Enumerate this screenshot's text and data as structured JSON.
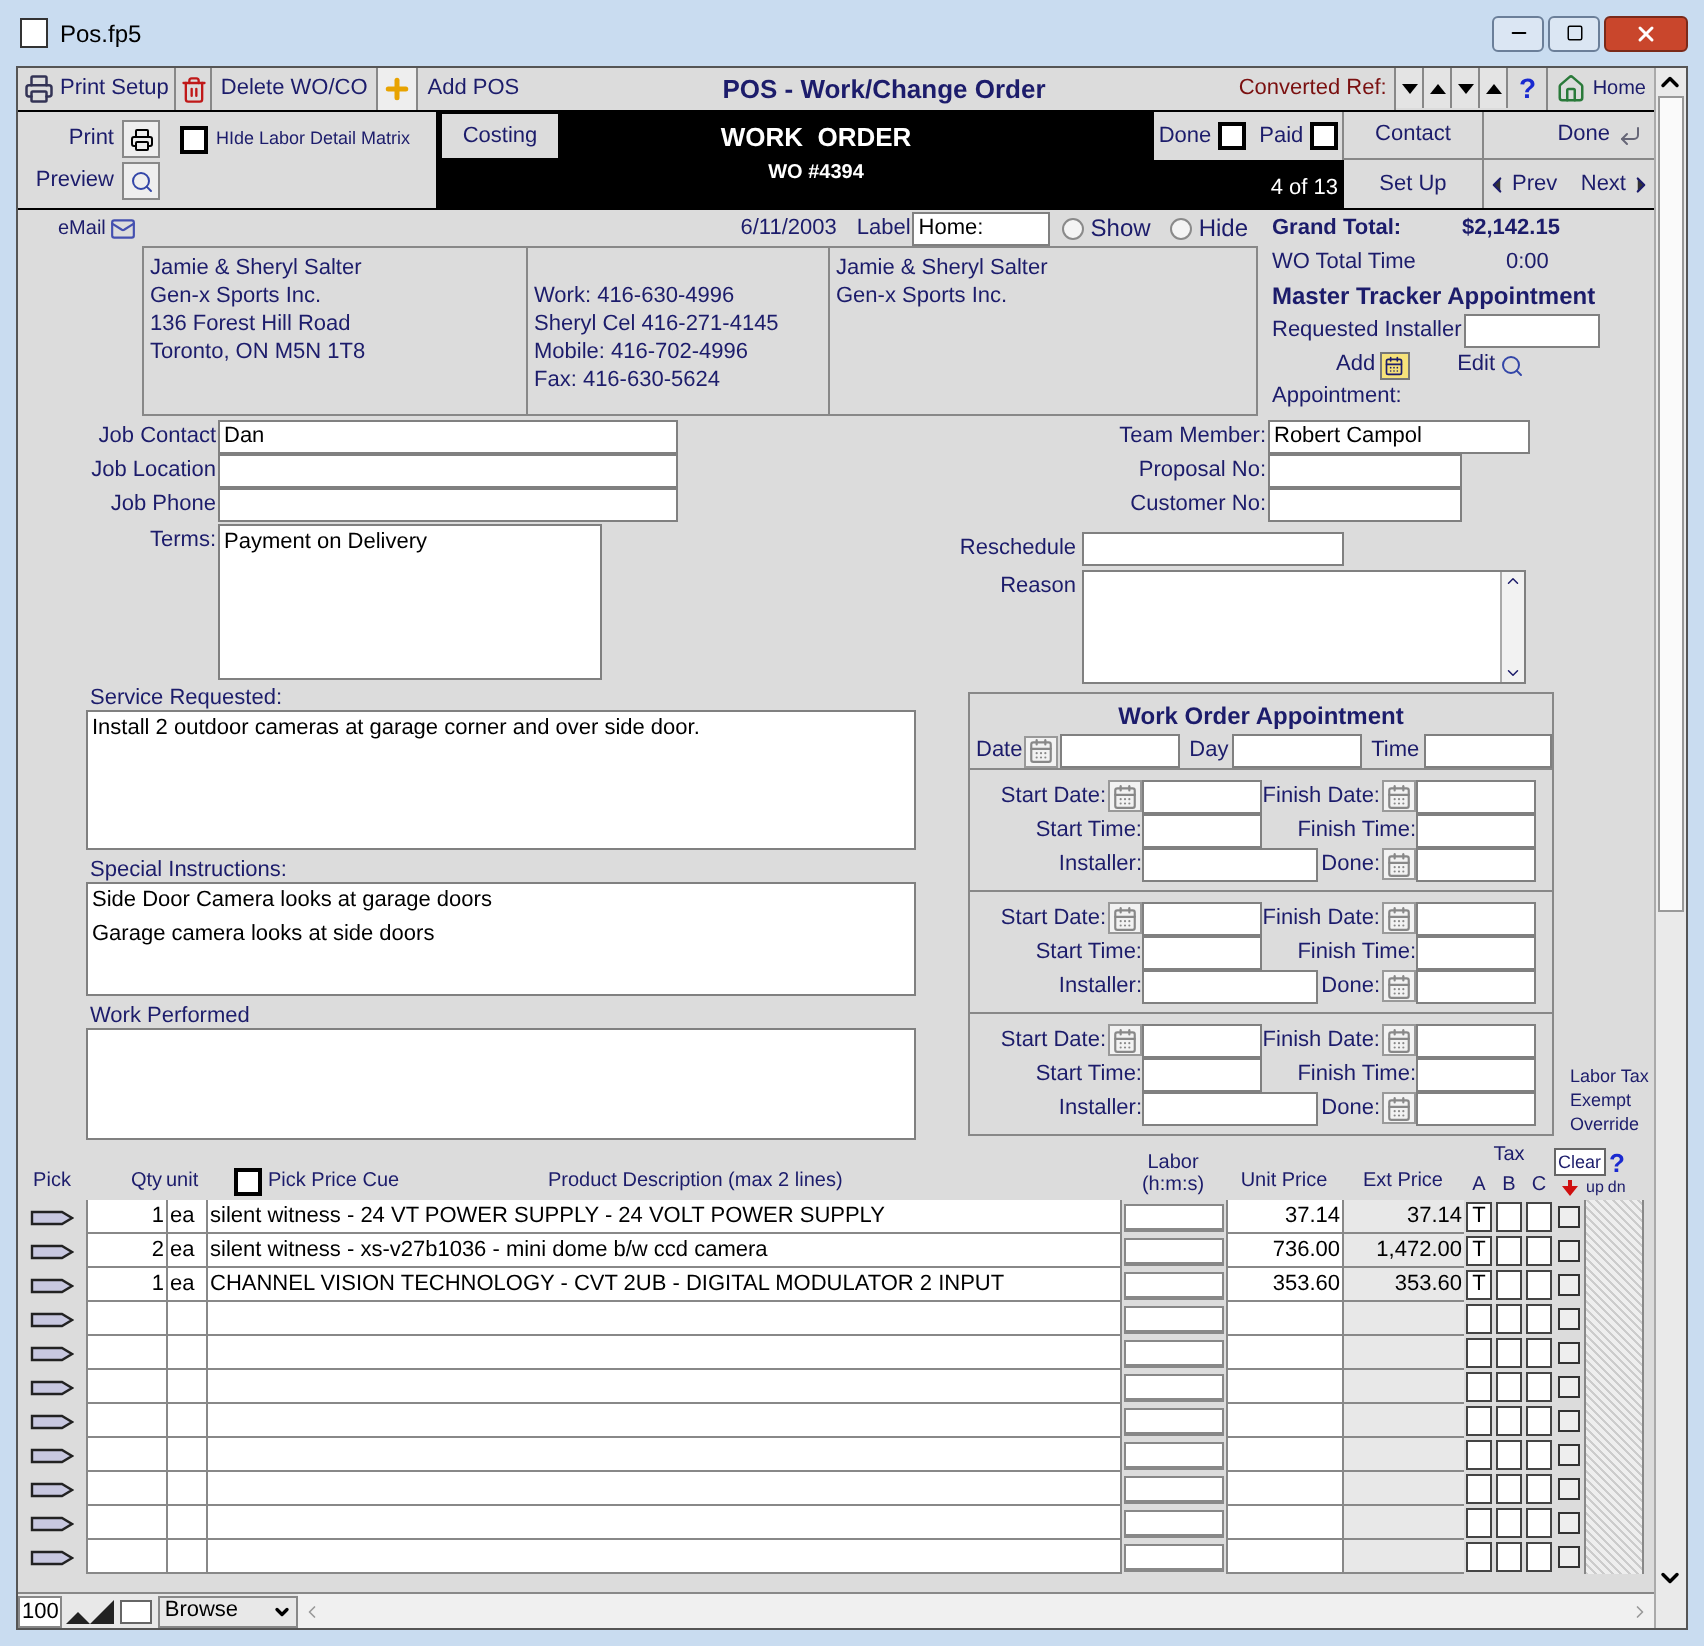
{
  "window": {
    "title": "Pos.fp5"
  },
  "toolbar": {
    "print_setup": "Print Setup",
    "delete": "Delete WO/CO",
    "add": "Add POS",
    "title": "POS - Work/Change Order",
    "converted_ref": "Converted Ref:",
    "help": "?",
    "home": "Home"
  },
  "header": {
    "print": "Print",
    "preview": "Preview",
    "hide_labor": {
      "label": "HIde Labor Detail Matrix",
      "checked": false
    },
    "costing": "Costing",
    "title": "WORK  ORDER",
    "number": "WO #4394",
    "done": {
      "label": "Done",
      "checked": false
    },
    "paid": {
      "label": "Paid",
      "checked": false
    },
    "contact": "Contact",
    "done_button": "Done",
    "record": "4 of 13",
    "setup": "Set Up",
    "prev": "Prev",
    "next": "Next"
  },
  "email": "eMail",
  "date": "6/11/2003",
  "label_field": {
    "label": "Label",
    "value": "Home:"
  },
  "label_options": [
    {
      "label": "Show",
      "selected": false
    },
    {
      "label": "Hide",
      "selected": false
    }
  ],
  "customer": {
    "billing": [
      "Jamie & Sheryl Salter",
      "Gen-x Sports Inc.",
      "136 Forest Hill Road",
      "Toronto, ON M5N 1T8"
    ],
    "phones": [
      "Work: 416-630-4996",
      "Sheryl Cel 416-271-4145",
      "Mobile: 416-702-4996",
      "Fax: 416-630-5624"
    ],
    "shipping": [
      "Jamie & Sheryl Salter",
      "Gen-x Sports Inc."
    ]
  },
  "summary": {
    "grand_total_label": "Grand Total:",
    "grand_total": "$2,142.15",
    "time_label": "WO Total Time",
    "time": "0:00",
    "tracker_title": "Master Tracker Appointment",
    "installer_label": "Requested Installer",
    "add": "Add",
    "edit": "Edit",
    "appointment": "Appointment:"
  },
  "job_fields": [
    {
      "label": "Job Contact",
      "value": "Dan"
    },
    {
      "label": "Job Location"
    },
    {
      "label": "Job Phone"
    }
  ],
  "terms": {
    "label": "Terms:",
    "value": "Payment on Delivery"
  },
  "staff_fields": [
    {
      "label": "Team Member:",
      "value": "Robert Campol"
    },
    {
      "label": "Proposal No:"
    },
    {
      "label": "Customer No:"
    }
  ],
  "reschedule": {
    "label": "Reschedule"
  },
  "reason": {
    "label": "Reason"
  },
  "service_requested": {
    "label": "Service Requested:",
    "value": "Install 2 outdoor cameras at garage corner and over side door."
  },
  "special_instructions": {
    "label": "Special Instructions:",
    "lines": [
      "Side Door Camera looks at garage doors",
      "Garage camera looks at side doors"
    ]
  },
  "work_performed": {
    "label": "Work Performed"
  },
  "appointment": {
    "title": "Work Order Appointment",
    "date": "Date",
    "day": "Day",
    "time": "Time",
    "slots": [
      {
        "start_date": "Start Date:",
        "finish_date": "Finish Date:",
        "start_time": "Start Time:",
        "finish_time": "Finish Time:",
        "installer": "Installer:",
        "done": "Done:"
      },
      {
        "start_date": "Start Date:",
        "finish_date": "Finish Date:",
        "start_time": "Start Time:",
        "finish_time": "Finish Time:",
        "installer": "Installer:",
        "done": "Done:"
      },
      {
        "start_date": "Start Date:",
        "finish_date": "Finish Date:",
        "start_time": "Start Time:",
        "finish_time": "Finish Time:",
        "installer": "Installer:",
        "done": "Done:"
      }
    ]
  },
  "labor_tax": {
    "label": "Labor Tax Exempt Override",
    "clear": "Clear",
    "help": "?"
  },
  "table": {
    "columns": {
      "pick": "Pick",
      "qty": "Qty",
      "unit": "unit",
      "price_cue": {
        "label": "Pick Price Cue",
        "checked": false
      },
      "description": "Product Description (max 2 lines)",
      "labor": "Labor (h:m:s)",
      "unit_price": "Unit Price",
      "ext_price": "Ext Price",
      "tax": "Tax",
      "tax_a": "A",
      "tax_b": "B",
      "tax_c": "C",
      "up": "up",
      "dn": "dn"
    },
    "rows": [
      {
        "kind": "item",
        "qty": "1",
        "unit": "ea",
        "description": "silent witness - 24 VT POWER SUPPLY - 24 VOLT POWER SUPPLY",
        "unit_price": "37.14",
        "ext_price": "37.14",
        "tax_a": "T",
        "override": false
      },
      {
        "kind": "item",
        "qty": "2",
        "unit": "ea",
        "description": "silent witness - xs-v27b1036 - mini dome b/w ccd camera",
        "unit_price": "736.00",
        "ext_price": "1,472.00",
        "tax_a": "T",
        "override": false
      },
      {
        "kind": "item",
        "qty": "1",
        "unit": "ea",
        "description": "CHANNEL VISION TECHNOLOGY - CVT 2UB - DIGITAL MODULATOR  2 INPUT",
        "unit_price": "353.60",
        "ext_price": "353.60",
        "tax_a": "T",
        "override": false
      },
      {
        "kind": "empty",
        "override": false
      },
      {
        "kind": "empty",
        "override": false
      },
      {
        "kind": "empty",
        "override": false
      },
      {
        "kind": "empty",
        "override": false
      },
      {
        "kind": "empty",
        "override": false
      },
      {
        "kind": "empty",
        "override": false
      },
      {
        "kind": "empty",
        "override": false
      },
      {
        "kind": "empty",
        "override": false
      }
    ]
  },
  "status_bar": {
    "zoom": "100",
    "mode": "Browse"
  }
}
